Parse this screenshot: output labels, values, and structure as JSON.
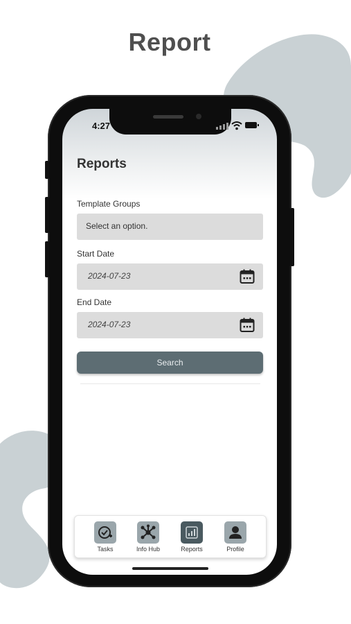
{
  "hero": {
    "title": "Report"
  },
  "status_bar": {
    "time": "4:27"
  },
  "screen": {
    "title": "Reports"
  },
  "form": {
    "template_groups": {
      "label": "Template Groups",
      "value": "Select an option."
    },
    "start_date": {
      "label": "Start Date",
      "value": "2024-07-23"
    },
    "end_date": {
      "label": "End Date",
      "value": "2024-07-23"
    },
    "search_label": "Search"
  },
  "tabs": [
    {
      "label": "Tasks",
      "icon": "task-check-icon",
      "active": false
    },
    {
      "label": "Info Hub",
      "icon": "network-hub-icon",
      "active": false
    },
    {
      "label": "Reports",
      "icon": "bar-chart-icon",
      "active": true
    },
    {
      "label": "Profile",
      "icon": "person-icon",
      "active": false
    }
  ],
  "colors": {
    "accent": "#5d6d73",
    "tab_icon": "#9aa6ab",
    "tab_icon_active": "#4a5a60",
    "field_bg": "#dcdcdc",
    "blob": "#c9d1d4"
  }
}
